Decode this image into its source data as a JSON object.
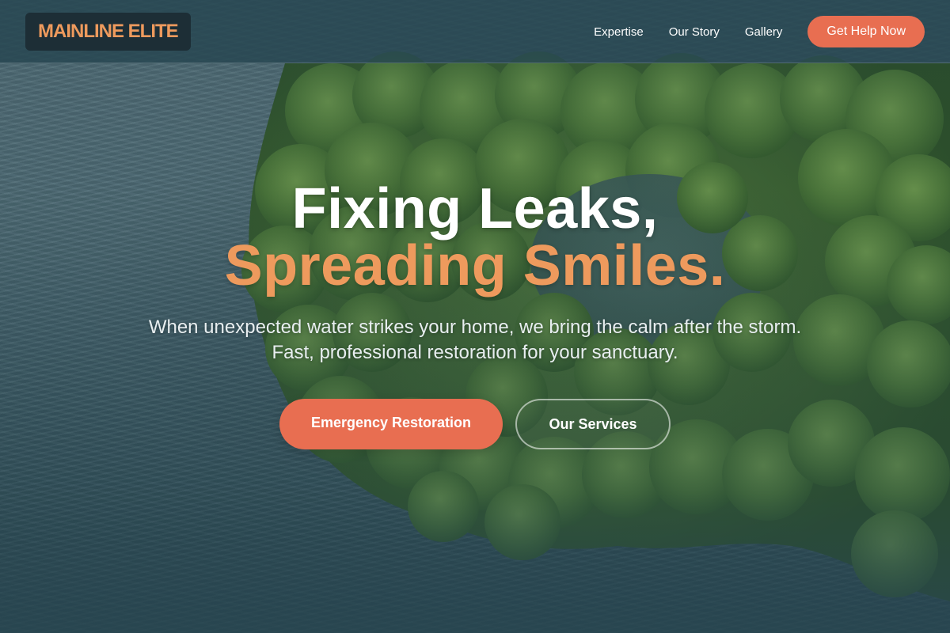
{
  "brand": {
    "name": "MAINLINE ELITE",
    "accent": "#ee9a5d",
    "cta_color": "#e86e51"
  },
  "nav": {
    "links": [
      "Expertise",
      "Our Story",
      "Gallery"
    ],
    "cta_label": "Get Help Now"
  },
  "hero": {
    "headline_line1": "Fixing Leaks,",
    "headline_line2": "Spreading Smiles.",
    "subtitle_line1": "When unexpected water strikes your home, we bring the calm after the storm.",
    "subtitle_line2": "Fast, professional restoration for your sanctuary.",
    "primary_button": "Emergency Restoration",
    "secondary_button": "Our Services",
    "background": "aerial-water-forest-image"
  }
}
